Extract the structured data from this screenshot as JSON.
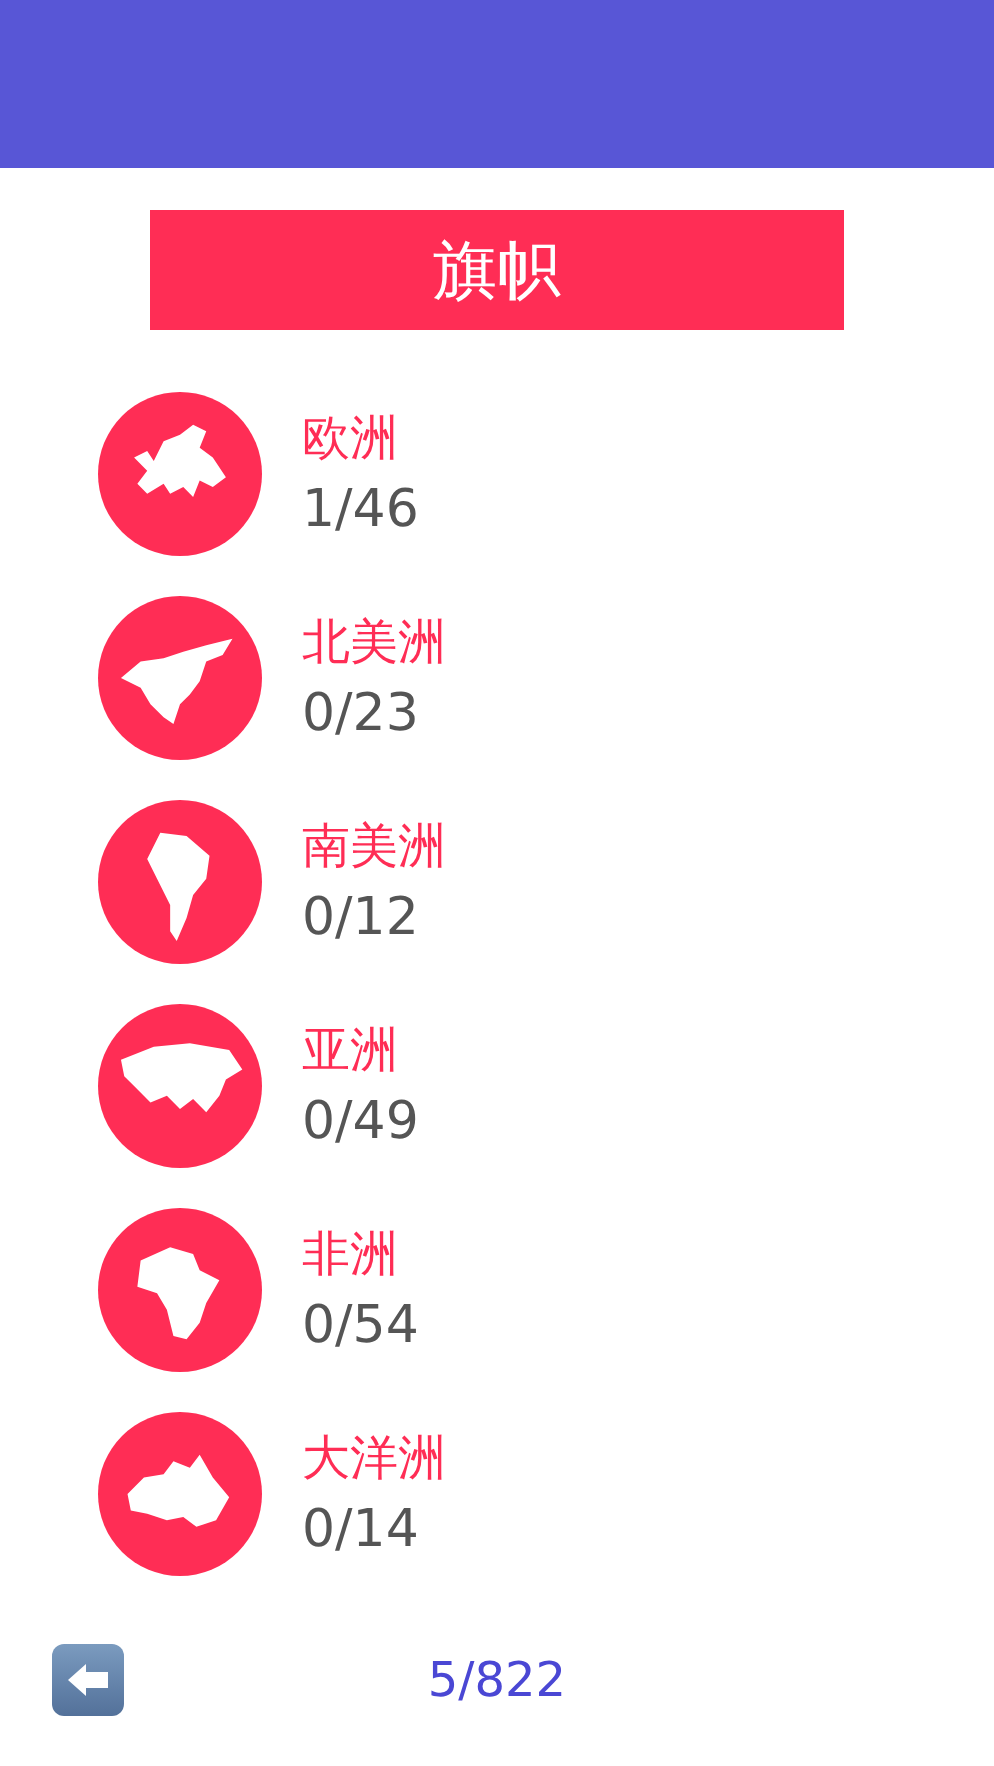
{
  "title": "旗帜",
  "continents": [
    {
      "kind": "europe",
      "name": "欧洲",
      "count": "1/46"
    },
    {
      "kind": "north-america",
      "name": "北美洲",
      "count": "0/23"
    },
    {
      "kind": "south-america",
      "name": "南美洲",
      "count": "0/12"
    },
    {
      "kind": "asia",
      "name": "亚洲",
      "count": "0/49"
    },
    {
      "kind": "africa",
      "name": "非洲",
      "count": "0/54"
    },
    {
      "kind": "oceania",
      "name": "大洋洲",
      "count": "0/14"
    }
  ],
  "footer": {
    "progress": "5/822"
  }
}
